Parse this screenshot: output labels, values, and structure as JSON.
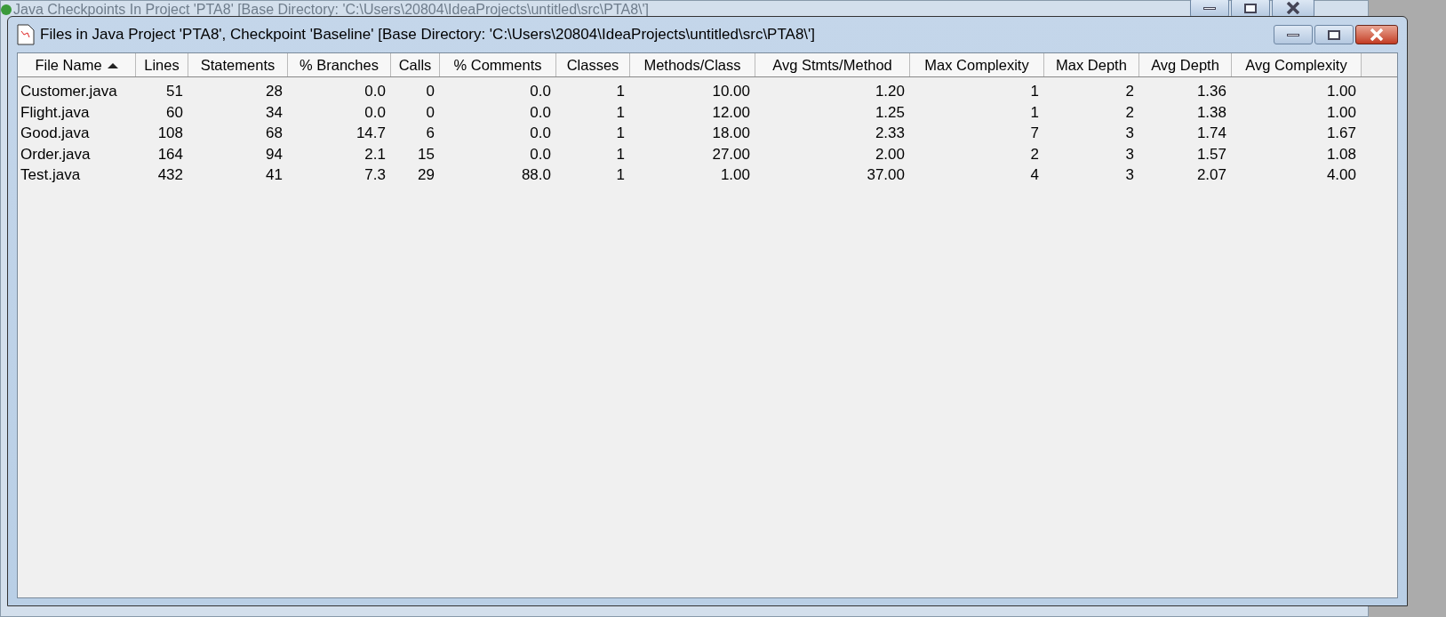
{
  "background_window": {
    "title": "Java Checkpoints In Project 'PTA8'  [Base Directory: 'C:\\Users\\20804\\IdeaProjects\\untitled\\src\\PTA8\\']"
  },
  "window": {
    "title": "Files in Java Project 'PTA8', Checkpoint 'Baseline'  [Base Directory: 'C:\\Users\\20804\\IdeaProjects\\untitled\\src\\PTA8\\']"
  },
  "table": {
    "columns": [
      {
        "label": "File Name",
        "sorted": true
      },
      {
        "label": "Lines",
        "sorted": false
      },
      {
        "label": "Statements",
        "sorted": false
      },
      {
        "label": "% Branches",
        "sorted": false
      },
      {
        "label": "Calls",
        "sorted": false
      },
      {
        "label": "% Comments",
        "sorted": false
      },
      {
        "label": "Classes",
        "sorted": false
      },
      {
        "label": "Methods/Class",
        "sorted": false
      },
      {
        "label": "Avg Stmts/Method",
        "sorted": false
      },
      {
        "label": "Max Complexity",
        "sorted": false
      },
      {
        "label": "Max Depth",
        "sorted": false
      },
      {
        "label": "Avg Depth",
        "sorted": false
      },
      {
        "label": "Avg Complexity",
        "sorted": false
      }
    ],
    "rows": [
      [
        "Customer.java",
        "51",
        "28",
        "0.0",
        "0",
        "0.0",
        "1",
        "10.00",
        "1.20",
        "1",
        "2",
        "1.36",
        "1.00"
      ],
      [
        "Flight.java",
        "60",
        "34",
        "0.0",
        "0",
        "0.0",
        "1",
        "12.00",
        "1.25",
        "1",
        "2",
        "1.38",
        "1.00"
      ],
      [
        "Good.java",
        "108",
        "68",
        "14.7",
        "6",
        "0.0",
        "1",
        "18.00",
        "2.33",
        "7",
        "3",
        "1.74",
        "1.67"
      ],
      [
        "Order.java",
        "164",
        "94",
        "2.1",
        "15",
        "0.0",
        "1",
        "27.00",
        "2.00",
        "2",
        "3",
        "1.57",
        "1.08"
      ],
      [
        "Test.java",
        "432",
        "41",
        "7.3",
        "29",
        "88.0",
        "1",
        "1.00",
        "37.00",
        "4",
        "3",
        "2.07",
        "4.00"
      ]
    ]
  }
}
